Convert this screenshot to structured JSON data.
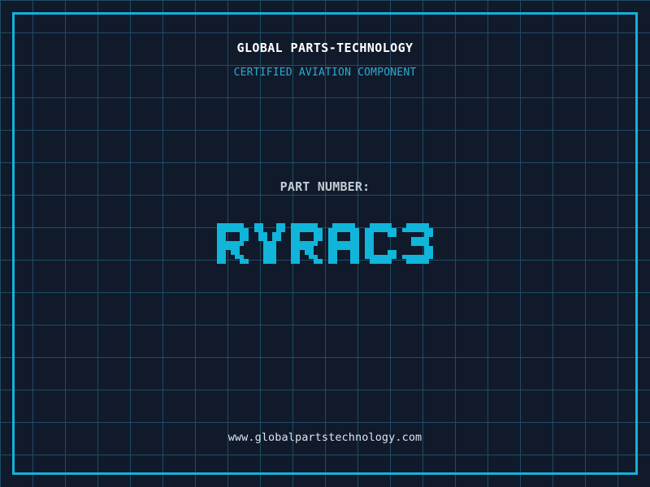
{
  "page": {
    "background_color": "#101a2b",
    "grid_color": "#1d4d66",
    "frame_color": "#15b1d9"
  },
  "header": {
    "title": "GLOBAL PARTS-TECHNOLOGY",
    "title_color": "#ffffff",
    "subtitle": "CERTIFIED AVIATION COMPONENT",
    "subtitle_color": "#2da9cd"
  },
  "part": {
    "label": "PART NUMBER:",
    "label_color": "#c3cbd3",
    "value": "RYRAC3",
    "value_color": "#10b5d9"
  },
  "footer": {
    "website": "www.globalpartstechnology.com",
    "color": "#dde3e8"
  }
}
